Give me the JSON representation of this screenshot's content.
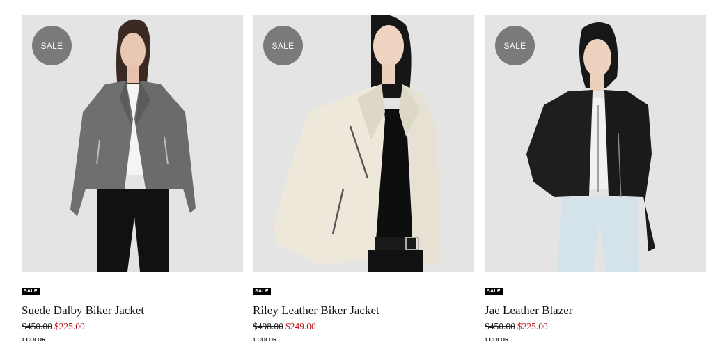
{
  "products": [
    {
      "badge": "SALE",
      "tag": "SALE",
      "name": "Suede Dalby Biker Jacket",
      "was_price": "$450.00",
      "sale_price": "$225.00",
      "colors": "1 COLOR",
      "jacket_color": "#6f6f6f"
    },
    {
      "badge": "SALE",
      "tag": "SALE",
      "name": "Riley Leather Biker Jacket",
      "was_price": "$498.00",
      "sale_price": "$249.00",
      "colors": "1 COLOR",
      "jacket_color": "#ece7d9"
    },
    {
      "badge": "SALE",
      "tag": "SALE",
      "name": "Jae Leather Blazer",
      "was_price": "$450.00",
      "sale_price": "$225.00",
      "colors": "1 COLOR",
      "jacket_color": "#1e1e1e"
    }
  ],
  "colors": {
    "sale_badge_bg": "#7a7a7a",
    "sale_price": "#c0141c",
    "photo_bg": "#e4e4e4"
  }
}
